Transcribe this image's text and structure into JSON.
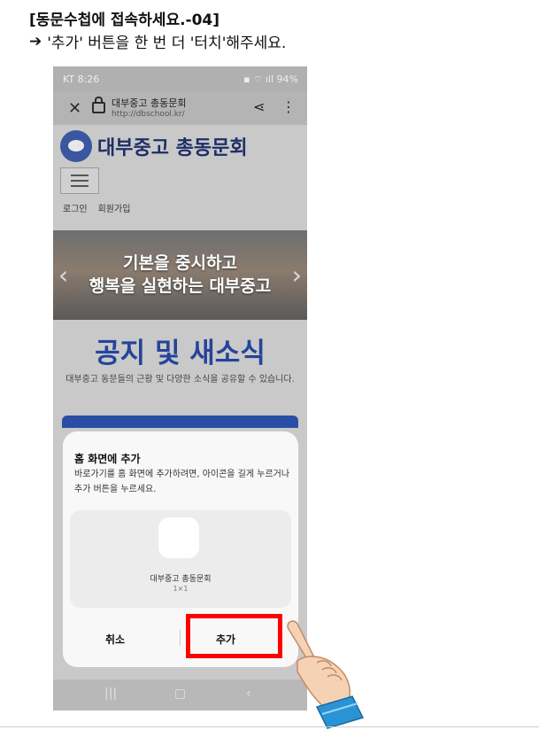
{
  "document": {
    "title": "[동문수첩에 접속하세요.-04]",
    "instruction": "'추가' 버튼을 한 번 더 '터치'해주세요."
  },
  "status_bar": {
    "carrier_time": "KT 8:26",
    "battery": "94%"
  },
  "browser": {
    "site_name": "대부중고 총동문회",
    "url": "http://dbschool.kr/"
  },
  "site": {
    "title": "대부중고 총동문회",
    "nav": [
      "로그인",
      "회원가입"
    ],
    "hero_line1": "기본을 중시하고",
    "hero_line2": "행복을 실현하는 대부중고",
    "notice_title": "공지 및 새소식",
    "notice_desc": "대부중고 동문들의 근황 및 다양한 소식을 공유할 수 있습니다."
  },
  "dialog": {
    "title": "홈 화면에 추가",
    "body": "바로가기를 홈 화면에 추가하려면, 아이콘을 길게 누르거나 추가 버튼을 누르세요.",
    "app_name": "대부중고 총동문회",
    "app_size": "1×1",
    "cancel_label": "취소",
    "add_label": "추가"
  },
  "colors": {
    "highlight": "#ff0000",
    "brand_blue": "#25449a"
  }
}
